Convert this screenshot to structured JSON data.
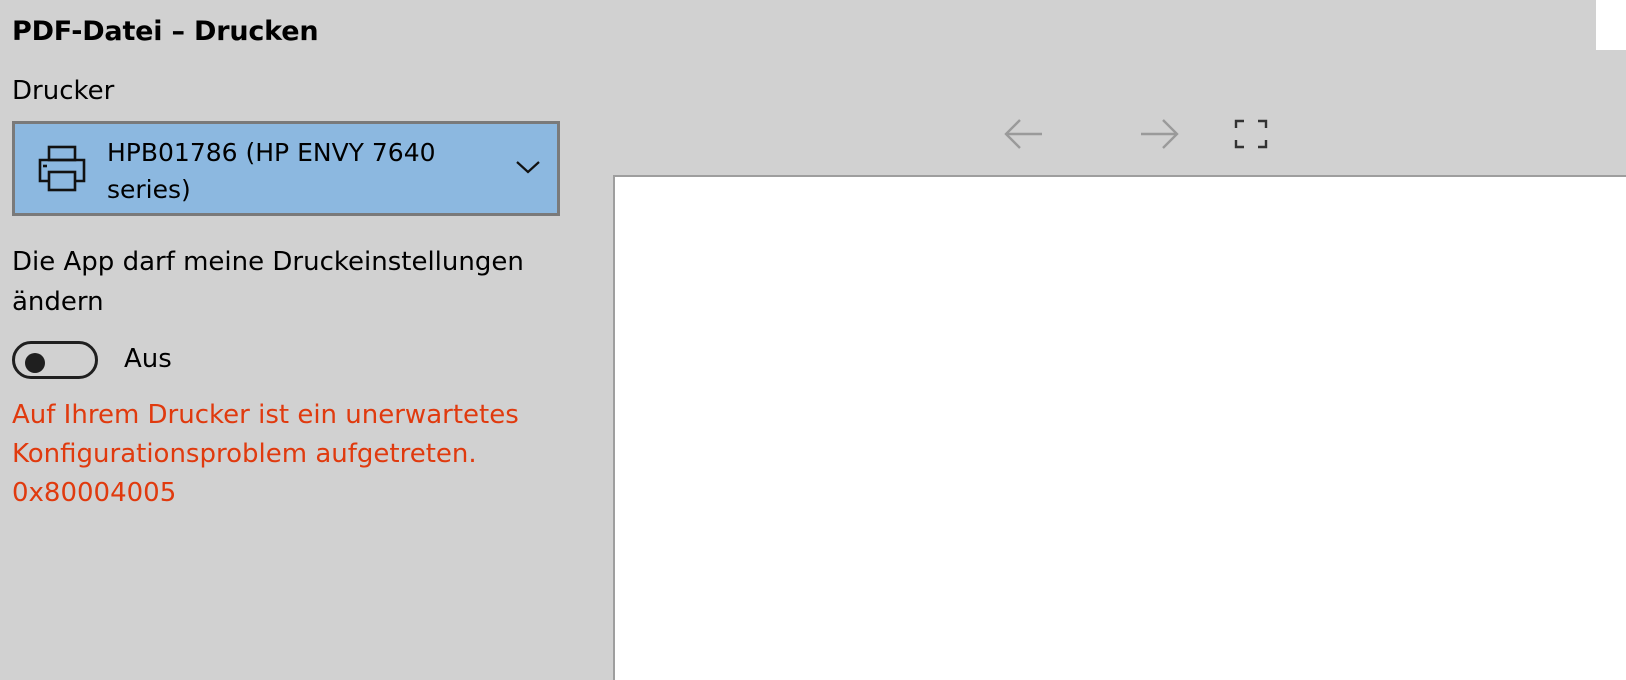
{
  "dialog": {
    "title": "PDF-Datei – Drucken"
  },
  "printer": {
    "label": "Drucker",
    "selected": "HPB01786 (HP ENVY 7640 series)",
    "icon": "printer-icon",
    "dropdown_icon": "chevron-down-icon"
  },
  "permission": {
    "label": "Die App darf meine Druckeinstellungen ändern",
    "toggle_state": "Aus",
    "toggle_on": false
  },
  "error": {
    "message": "Auf Ihrem Drucker ist ein unerwartetes Konfigurationsproblem aufgetreten. 0x80004005"
  },
  "preview_toolbar": {
    "back_icon": "arrow-left-icon",
    "forward_icon": "arrow-right-icon",
    "fit_icon": "fit-page-icon"
  },
  "colors": {
    "background": "#d1d1d1",
    "select_background": "#8cb8e0",
    "error": "#e03a0e",
    "preview_page": "#ffffff"
  }
}
